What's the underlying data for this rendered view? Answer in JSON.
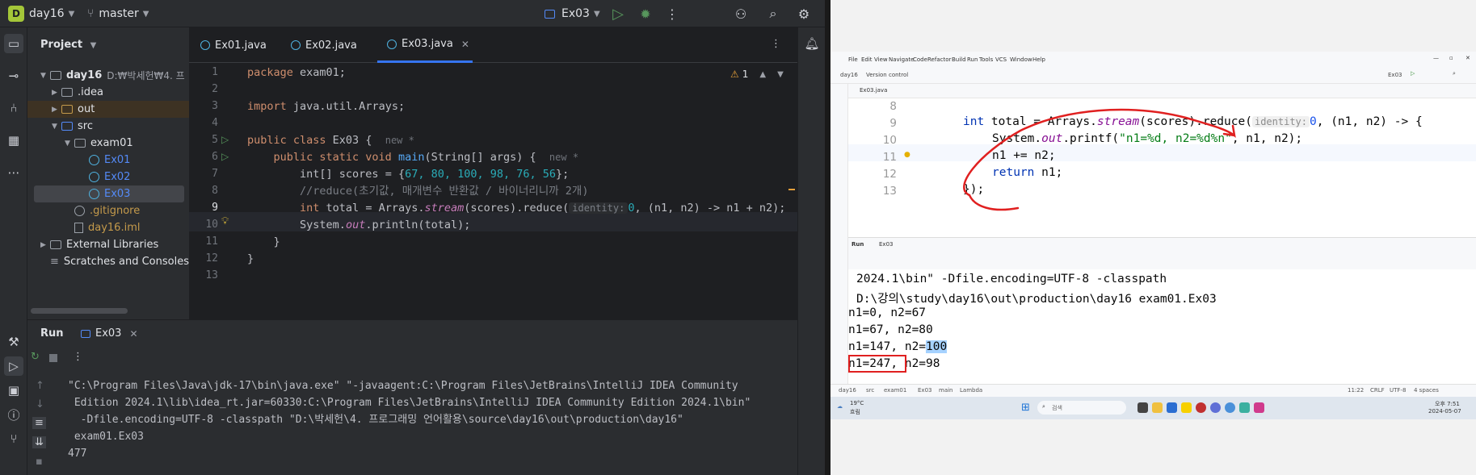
{
  "toolbar": {
    "project_badge": "D",
    "project_name": "day16",
    "branch": "master",
    "run_config": "Ex03"
  },
  "project_panel": {
    "title": "Project",
    "tree": [
      {
        "label": "day16",
        "path": "D:₩박세헌₩4. 프"
      },
      {
        "label": ".idea"
      },
      {
        "label": "out"
      },
      {
        "label": "src"
      },
      {
        "label": "exam01"
      },
      {
        "label": "Ex01"
      },
      {
        "label": "Ex02"
      },
      {
        "label": "Ex03"
      },
      {
        "label": ".gitignore"
      },
      {
        "label": "day16.iml"
      },
      {
        "label": "External Libraries"
      },
      {
        "label": "Scratches and Consoles"
      }
    ]
  },
  "editor": {
    "tabs": [
      "Ex01.java",
      "Ex02.java",
      "Ex03.java"
    ],
    "warning_count": "1",
    "line_numbers": [
      "1",
      "2",
      "3",
      "4",
      "5",
      "6",
      "7",
      "8",
      "9",
      "10",
      "11",
      "12",
      "13"
    ],
    "new_hint": "new *",
    "identity_hint": "identity:",
    "lines": {
      "l1_kw": "package",
      "l1_rest": " exam01;",
      "l3_kw": "import",
      "l3_rest": " java.util.Arrays;",
      "l5_kw": "public class",
      "l5_rest": " Ex03 {",
      "l6_kw": "public static void",
      "l6_fn": "main",
      "l6_rest": "(String[] args) {",
      "l7_a": "int[] scores = {",
      "l7_nums": "67, 80, 100, 98, 76, 56",
      "l7_b": "};",
      "l8_cmt": "//reduce(초기값, 매개변수 반환값 / 바이너리니까 2개)",
      "l9_kw": "int",
      "l9_a": " total = Arrays.",
      "l9_it": "stream",
      "l9_b": "(scores).reduce(",
      "l9_num": "0",
      "l9_c": ", (n1, n2) -> n1 + n2);",
      "l10_a": "System.",
      "l10_it": "out",
      "l10_b": ".println(total);",
      "l11": "}",
      "l12": "}"
    }
  },
  "run_panel": {
    "title": "Run",
    "tab": "Ex03",
    "output": [
      "\"C:\\Program Files\\Java\\jdk-17\\bin\\java.exe\" \"-javaagent:C:\\Program Files\\JetBrains\\IntelliJ IDEA Community",
      " Edition 2024.1\\lib\\idea_rt.jar=60330:C:\\Program Files\\JetBrains\\IntelliJ IDEA Community Edition 2024.1\\bin\"",
      "  -Dfile.encoding=UTF-8 -classpath \"D:\\박세헌\\4. 프로그래밍 언어활용\\source\\day16\\out\\production\\day16\"",
      " exam01.Ex03",
      "477"
    ]
  },
  "screenshot": {
    "menus": [
      "File",
      "Edit",
      "View",
      "Navigate",
      "Code",
      "Refactor",
      "Build",
      "Run",
      "Tools",
      "VCS",
      "Window",
      "Help"
    ],
    "project": "day16",
    "vcs": "Version control",
    "run_config": "Ex03",
    "tab": "Ex03.java",
    "line_numbers": [
      "8",
      "9",
      "10",
      "11",
      "12",
      "13"
    ],
    "code": {
      "l9_kw": "int",
      "l9_a": " total = Arrays.",
      "l9_it": "stream",
      "l9_b": "(scores).reduce(",
      "l9_hint": "identity:",
      "l9_num": "0",
      "l9_c": ", (n1, n2) -> {",
      "l10_a": "System.",
      "l10_it": "out",
      "l10_b": ".printf(",
      "l10_str": "\"n1=%d, n2=%d%n\"",
      "l10_c": ", n1, n2);",
      "l11": "n1 += n2;",
      "l12_kw": "return",
      "l12_rest": " n1;",
      "l13": "});"
    },
    "run_label": "Run",
    "run_tab": "Ex03",
    "console": [
      "2024.1\\bin\" -Dfile.encoding=UTF-8 -classpath",
      "D:\\강의\\study\\day16\\out\\production\\day16 exam01.Ex03",
      "n1=0, n2=67",
      "n1=67, n2=80",
      "n1=147, n2=",
      "100",
      "n1=247",
      ", n2=98"
    ],
    "status": [
      "day16",
      "src",
      "exam01",
      "Ex03",
      "main",
      "Lambda"
    ],
    "status_right": [
      "11:22",
      "CRLF",
      "UTF-8",
      "4 spaces"
    ],
    "weather": "19°C",
    "weather_sub": "흐림",
    "search": "검색",
    "clock_time": "오후 7:51",
    "clock_date": "2024-05-07"
  },
  "colors": {
    "accent": "#3574f0",
    "run_green": "#57965c",
    "annotation_red": "#e02020"
  }
}
